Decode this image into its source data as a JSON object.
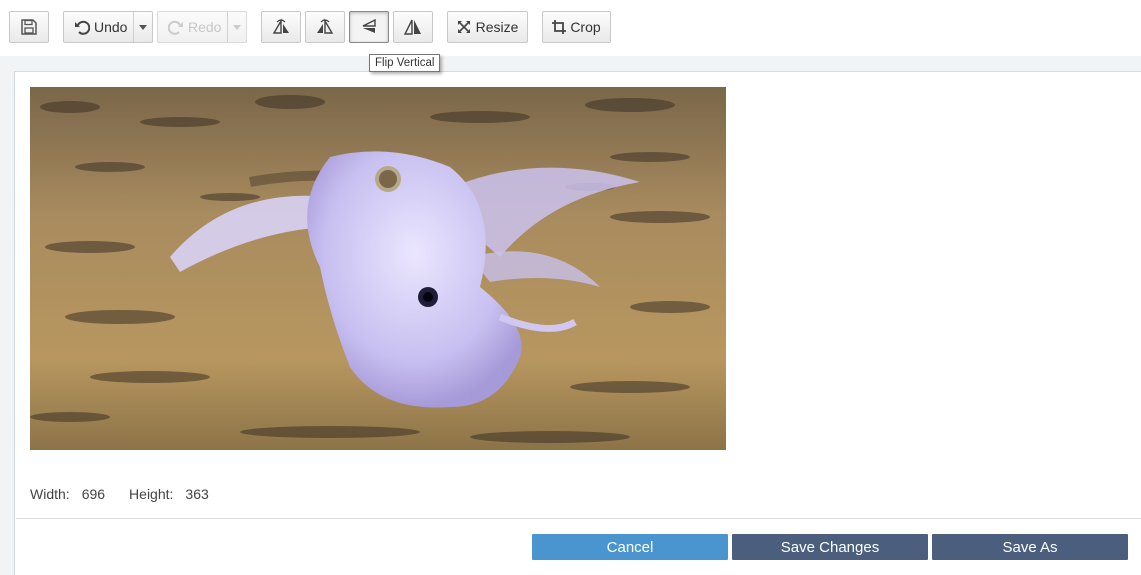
{
  "toolbar": {
    "save_icon": "floppy-disk-icon",
    "undo_label": "Undo",
    "redo_label": "Redo",
    "rotate_left_icon": "rotate-left-icon",
    "rotate_right_icon": "rotate-right-icon",
    "flip_vertical_icon": "flip-vertical-icon",
    "flip_horizontal_icon": "flip-horizontal-icon",
    "resize_label": "Resize",
    "crop_label": "Crop"
  },
  "tooltip": {
    "text": "Flip Vertical"
  },
  "image": {
    "description_icon": "photo"
  },
  "dimensions": {
    "width_label": "Width:",
    "width_value": "696",
    "height_label": "Height:",
    "height_value": "363"
  },
  "footer": {
    "cancel_label": "Cancel",
    "save_changes_label": "Save Changes",
    "save_as_label": "Save As"
  },
  "colors": {
    "cancel": "#4a95cf",
    "save": "#4b5e7e"
  }
}
